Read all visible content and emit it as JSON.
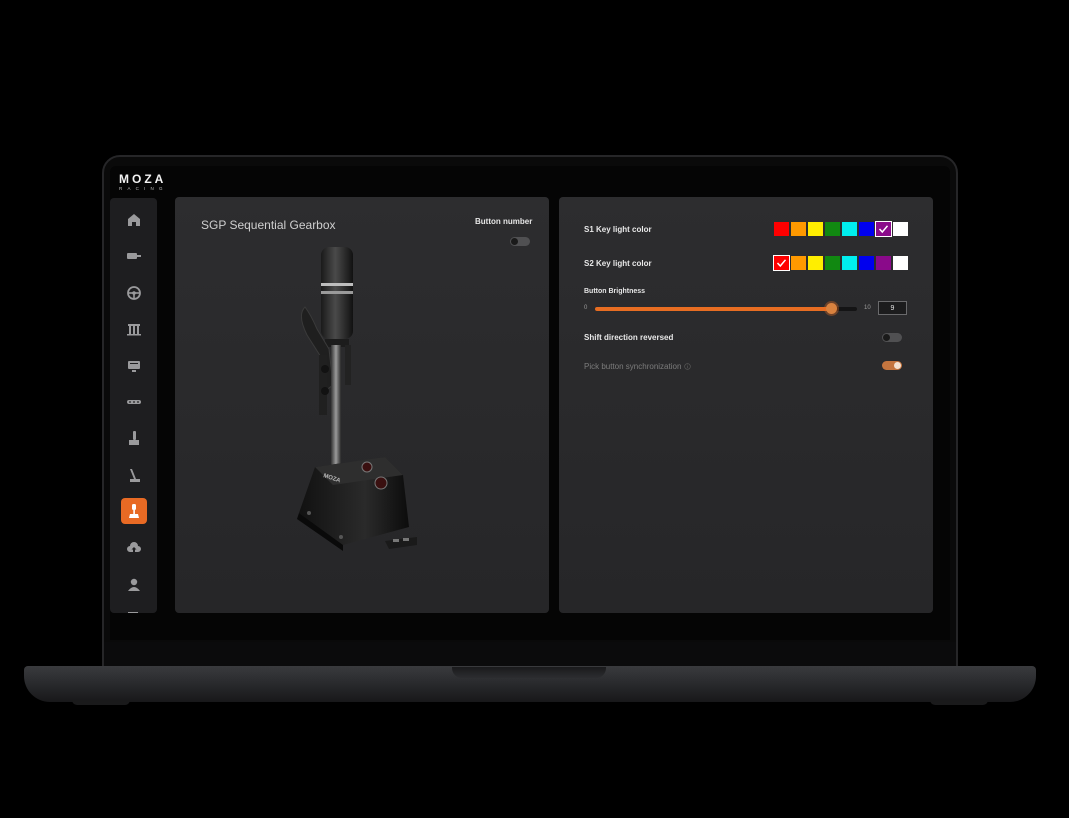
{
  "app": {
    "brand": "MOZA",
    "brand_sub": "RACING"
  },
  "sidebar": {
    "items": [
      {
        "icon": "home-icon"
      },
      {
        "icon": "wheelbase-icon"
      },
      {
        "icon": "steering-wheel-icon"
      },
      {
        "icon": "pedals-icon"
      },
      {
        "icon": "dashboard-icon"
      },
      {
        "icon": "led-strip-icon"
      },
      {
        "icon": "handbrake-icon"
      },
      {
        "icon": "h-shifter-icon"
      },
      {
        "icon": "sequential-shifter-icon",
        "active": true
      },
      {
        "icon": "cloud-icon"
      },
      {
        "icon": "user-icon"
      }
    ]
  },
  "left_panel": {
    "title": "SGP Sequential Gearbox",
    "button_number_label": "Button number",
    "button_number_on": false
  },
  "right_panel": {
    "s1_label": "S1 Key light color",
    "s2_label": "S2 Key light color",
    "palette": [
      "#ff0000",
      "#ff9900",
      "#ffee00",
      "#118811",
      "#00eeee",
      "#0000ee",
      "#8a0a8a",
      "#ffffff"
    ],
    "s1_selected_index": 6,
    "s2_selected_index": 0,
    "brightness_label": "Button  Brightness",
    "brightness_min": "0",
    "brightness_max": "10",
    "brightness_value": "9",
    "brightness_fraction": 0.9,
    "shift_reversed_label": "Shift direction reversed",
    "shift_reversed_on": false,
    "pick_sync_label": "Pick button synchronization",
    "pick_sync_on": true
  },
  "colors": {
    "accent": "#e86a24",
    "panel": "#2b2b2d",
    "background": "#000000"
  }
}
